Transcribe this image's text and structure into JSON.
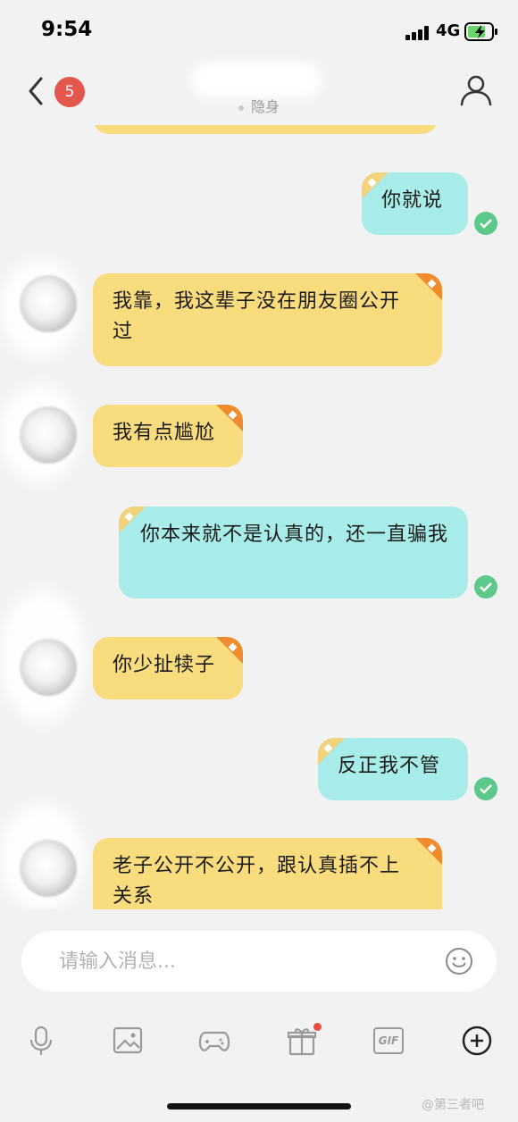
{
  "status_bar": {
    "time": "9:54",
    "network": "4G"
  },
  "header": {
    "unread_badge": "5",
    "status_text": "隐身"
  },
  "messages": [
    {
      "side": "out",
      "text": "你就说"
    },
    {
      "side": "in",
      "text": "我靠，我这辈子没在朋友圈公开过"
    },
    {
      "side": "in",
      "text": "我有点尴尬"
    },
    {
      "side": "out",
      "text": "你本来就不是认真的，还一直骗我"
    },
    {
      "side": "in",
      "text": "你少扯犊子"
    },
    {
      "side": "out",
      "text": "反正我不管"
    },
    {
      "side": "in",
      "text": "老子公开不公开，跟认真插不上关系"
    }
  ],
  "input": {
    "placeholder": "请输入消息..."
  },
  "toolbar": {
    "icons": [
      "microphone-icon",
      "image-icon",
      "gamepad-icon",
      "gift-icon",
      "gif-icon",
      "plus-icon"
    ],
    "gif_label": "GIF"
  },
  "watermark": "@第三者吧",
  "colors": {
    "incoming_bubble": "#f9dc7e",
    "outgoing_bubble": "#a8ecea",
    "read_check": "#5cc88a",
    "badge": "#e5574c",
    "corner_badge": "#f08c2e"
  }
}
